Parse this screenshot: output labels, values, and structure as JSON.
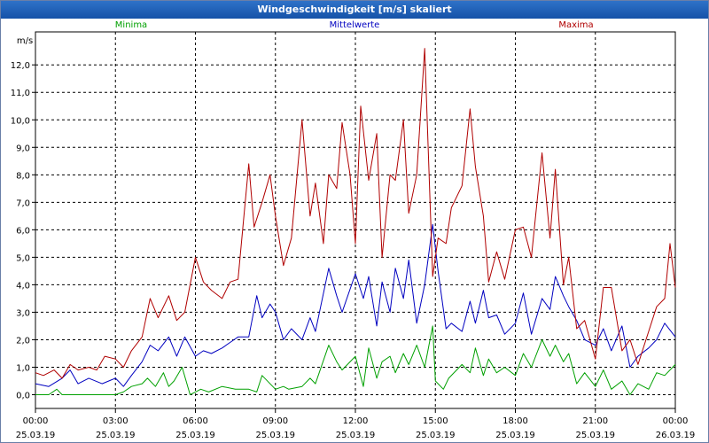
{
  "chart_data": {
    "type": "line",
    "title": "Windgeschwindigkeit [m/s] skaliert",
    "ylabel": "m/s",
    "ylim": [
      -0.5,
      13.2
    ],
    "xlim": [
      0,
      24
    ],
    "grid": true,
    "yticks": [
      "0,0",
      "1,0",
      "2,0",
      "3,0",
      "4,0",
      "5,0",
      "6,0",
      "7,0",
      "8,0",
      "9,0",
      "10,0",
      "11,0",
      "12,0"
    ],
    "xticks": [
      {
        "time": "00:00",
        "date": "25.03.19"
      },
      {
        "time": "03:00",
        "date": "25.03.19"
      },
      {
        "time": "06:00",
        "date": "25.03.19"
      },
      {
        "time": "09:00",
        "date": "25.03.19"
      },
      {
        "time": "12:00",
        "date": "25.03.19"
      },
      {
        "time": "15:00",
        "date": "25.03.19"
      },
      {
        "time": "18:00",
        "date": "25.03.19"
      },
      {
        "time": "21:00",
        "date": "25.03.19"
      },
      {
        "time": "00:00",
        "date": "26.03.19"
      }
    ],
    "series": [
      {
        "name": "Minima",
        "color": "#00a000",
        "x": [
          0,
          0.5,
          0.8,
          1,
          1.5,
          2,
          2.5,
          3,
          3.3,
          3.6,
          4,
          4.2,
          4.5,
          4.8,
          5,
          5.2,
          5.5,
          5.8,
          6,
          6.2,
          6.5,
          7,
          7.5,
          8,
          8.3,
          8.5,
          9,
          9.3,
          9.5,
          10,
          10.3,
          10.5,
          11,
          11.3,
          11.5,
          12,
          12.3,
          12.5,
          12.8,
          13,
          13.3,
          13.5,
          13.8,
          14,
          14.3,
          14.6,
          14.9,
          15,
          15.3,
          15.5,
          16,
          16.3,
          16.5,
          16.8,
          17,
          17.3,
          17.6,
          18,
          18.3,
          18.6,
          19,
          19.3,
          19.5,
          19.8,
          20,
          20.3,
          20.6,
          21,
          21.3,
          21.6,
          22,
          22.3,
          22.6,
          23,
          23.3,
          23.6,
          24
        ],
        "values": [
          0,
          0,
          0.2,
          0,
          0,
          0,
          0,
          0,
          0.1,
          0.3,
          0.4,
          0.6,
          0.3,
          0.8,
          0.3,
          0.5,
          1.0,
          0.0,
          0.1,
          0.2,
          0.1,
          0.3,
          0.2,
          0.2,
          0.1,
          0.7,
          0.2,
          0.3,
          0.2,
          0.3,
          0.6,
          0.4,
          1.8,
          1.2,
          0.9,
          1.4,
          0.3,
          1.7,
          0.6,
          1.2,
          1.4,
          0.8,
          1.5,
          1.1,
          1.8,
          1.0,
          2.5,
          0.5,
          0.2,
          0.6,
          1.1,
          0.8,
          1.7,
          0.7,
          1.3,
          0.8,
          1.0,
          0.7,
          1.5,
          1.0,
          2.0,
          1.4,
          1.8,
          1.2,
          1.5,
          0.4,
          0.8,
          0.3,
          0.9,
          0.2,
          0.5,
          0.0,
          0.4,
          0.2,
          0.8,
          0.7,
          1.1
        ]
      },
      {
        "name": "Mittelwerte",
        "color": "#0000c0",
        "x": [
          0,
          0.5,
          1,
          1.3,
          1.6,
          2,
          2.5,
          3,
          3.3,
          3.6,
          4,
          4.3,
          4.6,
          5,
          5.3,
          5.6,
          6,
          6.3,
          6.6,
          7,
          7.3,
          7.6,
          8,
          8.3,
          8.5,
          8.8,
          9,
          9.3,
          9.6,
          10,
          10.3,
          10.5,
          11,
          11.3,
          11.5,
          12,
          12.3,
          12.5,
          12.8,
          13,
          13.3,
          13.5,
          13.8,
          14,
          14.3,
          14.6,
          14.9,
          15.1,
          15.4,
          15.6,
          16,
          16.3,
          16.5,
          16.8,
          17,
          17.3,
          17.6,
          18,
          18.3,
          18.6,
          19,
          19.3,
          19.5,
          19.8,
          20,
          20.3,
          20.6,
          21,
          21.3,
          21.6,
          22,
          22.3,
          22.6,
          23,
          23.3,
          23.6,
          24
        ],
        "values": [
          0.4,
          0.3,
          0.6,
          0.9,
          0.4,
          0.6,
          0.4,
          0.6,
          0.3,
          0.7,
          1.2,
          1.8,
          1.6,
          2.1,
          1.4,
          2.1,
          1.4,
          1.6,
          1.5,
          1.7,
          1.9,
          2.1,
          2.1,
          3.6,
          2.8,
          3.3,
          3.0,
          2.0,
          2.4,
          2.0,
          2.8,
          2.3,
          4.6,
          3.6,
          3.0,
          4.4,
          3.5,
          4.3,
          2.5,
          4.1,
          3.0,
          4.6,
          3.5,
          4.9,
          2.6,
          4.0,
          6.2,
          4.5,
          2.4,
          2.6,
          2.3,
          3.4,
          2.6,
          3.8,
          2.8,
          2.9,
          2.2,
          2.6,
          3.7,
          2.2,
          3.5,
          3.1,
          4.3,
          3.6,
          3.2,
          2.7,
          2.0,
          1.8,
          2.4,
          1.6,
          2.5,
          1.0,
          1.4,
          1.7,
          2.0,
          2.6,
          2.1
        ]
      },
      {
        "name": "Maxima",
        "color": "#b00000",
        "x": [
          0,
          0.3,
          0.7,
          1,
          1.3,
          1.6,
          2,
          2.3,
          2.6,
          3,
          3.3,
          3.6,
          4,
          4.3,
          4.6,
          5,
          5.3,
          5.6,
          6,
          6.3,
          6.6,
          7,
          7.3,
          7.6,
          8,
          8.2,
          8.5,
          8.8,
          9,
          9.3,
          9.6,
          10,
          10.3,
          10.5,
          10.8,
          11,
          11.3,
          11.5,
          11.8,
          12,
          12.2,
          12.5,
          12.8,
          13,
          13.3,
          13.5,
          13.8,
          14,
          14.3,
          14.6,
          14.9,
          15.1,
          15.4,
          15.6,
          16,
          16.3,
          16.5,
          16.8,
          17,
          17.3,
          17.6,
          18,
          18.3,
          18.6,
          19,
          19.3,
          19.5,
          19.8,
          20,
          20.3,
          20.6,
          21,
          21.3,
          21.6,
          22,
          22.3,
          22.6,
          23,
          23.3,
          23.6,
          23.8,
          24
        ],
        "values": [
          0.8,
          0.7,
          0.9,
          0.6,
          1.1,
          0.9,
          1.0,
          0.9,
          1.4,
          1.3,
          1.0,
          1.6,
          2.1,
          3.5,
          2.8,
          3.6,
          2.7,
          3.0,
          5.0,
          4.1,
          3.8,
          3.5,
          4.1,
          4.2,
          8.4,
          6.1,
          7.0,
          8.0,
          6.5,
          4.7,
          5.7,
          10.0,
          6.5,
          7.7,
          5.5,
          8.0,
          7.5,
          9.9,
          8.0,
          5.5,
          10.5,
          7.8,
          9.5,
          5.0,
          8.0,
          7.8,
          10.0,
          6.6,
          8.0,
          12.6,
          4.3,
          5.7,
          5.5,
          6.8,
          7.6,
          10.4,
          8.3,
          6.5,
          4.1,
          5.2,
          4.2,
          6.0,
          6.1,
          5.0,
          8.8,
          5.7,
          8.2,
          4.0,
          5.0,
          2.4,
          2.7,
          1.3,
          3.9,
          3.9,
          1.6,
          2.0,
          1.1,
          2.3,
          3.2,
          3.5,
          5.5,
          3.9
        ]
      }
    ]
  }
}
